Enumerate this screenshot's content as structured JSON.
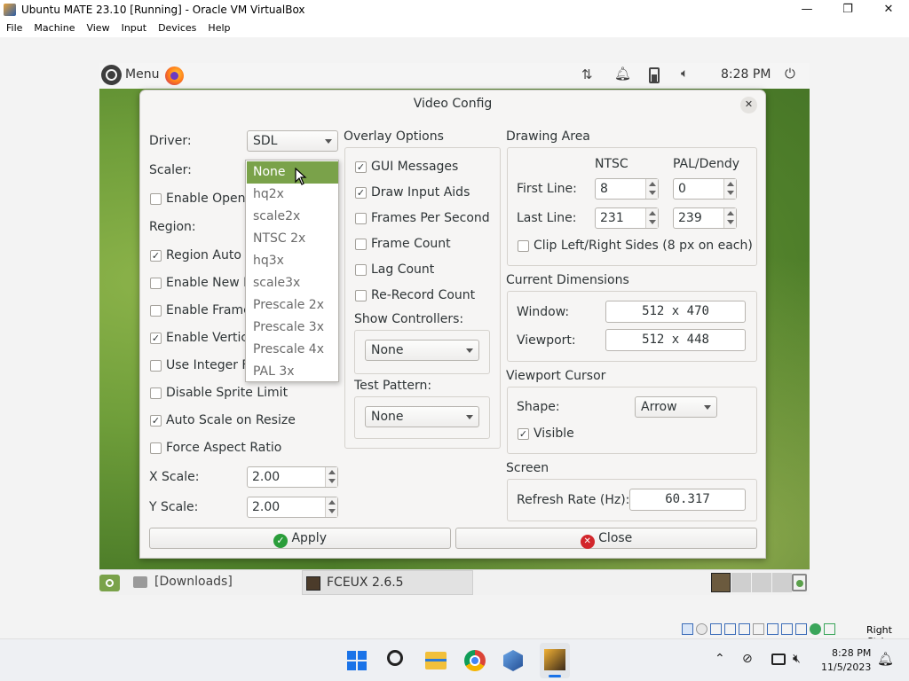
{
  "host": {
    "window_title": "Ubuntu MATE 23.10 [Running] - Oracle VM VirtualBox",
    "controls": {
      "minimize": "—",
      "maximize": "❐",
      "close": "✕"
    },
    "menu": [
      "File",
      "Machine",
      "View",
      "Input",
      "Devices",
      "Help"
    ],
    "statusbar_host_key": "Right Ctrl"
  },
  "guest_top_panel": {
    "menu_label": "Menu",
    "clock": "8:28 PM"
  },
  "guest_bottom_panel": {
    "downloads_label": "[Downloads]",
    "fceux_task_label": "FCEUX 2.6.5"
  },
  "dialog": {
    "title": "Video Config",
    "close_glyph": "✕",
    "left": {
      "driver_label": "Driver:",
      "driver_value": "SDL",
      "scaler_label": "Scaler:",
      "enable_opengl": "Enable Open",
      "region_label": "Region:",
      "region_auto": "Region Auto",
      "enable_new_ppu": "Enable New P",
      "enable_frame_skip": "Enable Frame",
      "enable_vsync": "Enable Vertic",
      "use_integer": "Use Integer F",
      "disable_sprite_limit": "Disable Sprite Limit",
      "auto_scale": "Auto Scale on Resize",
      "force_aspect": "Force Aspect Ratio",
      "x_scale_label": "X Scale:",
      "x_scale_value": "2.00",
      "y_scale_label": "Y Scale:",
      "y_scale_value": "2.00"
    },
    "scaler_options": [
      "None",
      "hq2x",
      "scale2x",
      "NTSC 2x",
      "hq3x",
      "scale3x",
      "Prescale 2x",
      "Prescale 3x",
      "Prescale 4x",
      "PAL 3x"
    ],
    "overlay": {
      "title": "Overlay Options",
      "gui_messages": "GUI Messages",
      "draw_input_aids": "Draw Input Aids",
      "fps": "Frames Per Second",
      "frame_count": "Frame Count",
      "lag_count": "Lag Count",
      "rerecord_count": "Re-Record Count",
      "show_controllers_label": "Show Controllers:",
      "show_controllers_value": "None",
      "test_pattern_label": "Test Pattern:",
      "test_pattern_value": "None"
    },
    "drawing_area": {
      "title": "Drawing Area",
      "ntsc_header": "NTSC",
      "pal_header": "PAL/Dendy",
      "first_line_label": "First Line:",
      "first_line_ntsc": "8",
      "first_line_pal": "0",
      "last_line_label": "Last Line:",
      "last_line_ntsc": "231",
      "last_line_pal": "239",
      "clip_sides": "Clip Left/Right Sides (8 px on each)"
    },
    "dimensions": {
      "title": "Current Dimensions",
      "window_label": "Window:",
      "window_value": "512 x 470",
      "viewport_label": "Viewport:",
      "viewport_value": "512 x 448"
    },
    "cursor": {
      "title": "Viewport Cursor",
      "shape_label": "Shape:",
      "shape_value": "Arrow",
      "visible_label": "Visible"
    },
    "screen": {
      "title": "Screen",
      "refresh_label": "Refresh Rate (Hz):",
      "refresh_value": "60.317"
    },
    "apply_label": "Apply",
    "close_label": "Close"
  },
  "taskbar": {
    "time": "8:28 PM",
    "date": "11/5/2023"
  },
  "colors": {
    "accent_green": "#7aa24a",
    "apply_icon": "#2a9d3a",
    "close_icon": "#d2262b"
  }
}
